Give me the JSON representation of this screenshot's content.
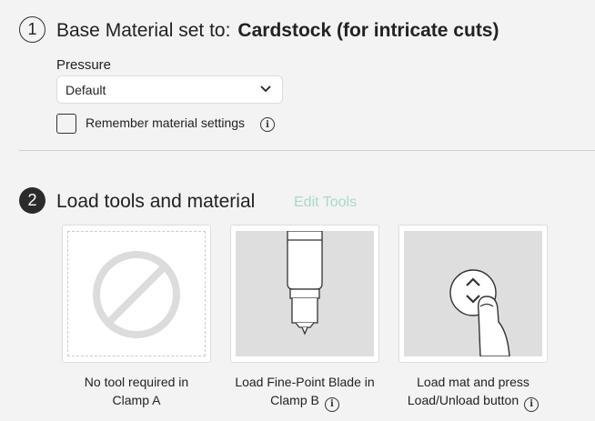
{
  "step1": {
    "number": "1",
    "title_prefix": "Base Material set to:",
    "material": "Cardstock (for intricate cuts)",
    "pressure": {
      "label": "Pressure",
      "value": "Default"
    },
    "remember": {
      "label": "Remember material settings",
      "checked": false
    }
  },
  "step2": {
    "number": "2",
    "title": "Load tools and material",
    "edit_tools": "Edit Tools",
    "cards": [
      {
        "line1": "No tool required in",
        "line2": "Clamp A",
        "has_info": false
      },
      {
        "line1": "Load Fine-Point Blade in",
        "line2": "Clamp B",
        "has_info": true
      },
      {
        "line1": "Load mat and press",
        "line2": "Load/Unload button",
        "has_info": true
      }
    ]
  },
  "colors": {
    "edit_tools": "#a9d9c6",
    "background": "#f3f3f3"
  }
}
